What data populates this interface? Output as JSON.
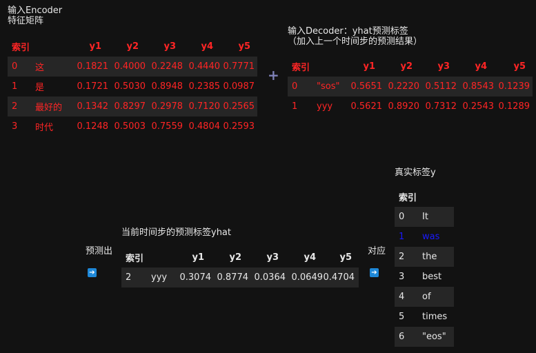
{
  "encoder": {
    "caption": "输入Encoder\n特征矩阵",
    "headers": [
      "索引",
      "",
      "y1",
      "y2",
      "y3",
      "y4",
      "y5"
    ],
    "rows": [
      [
        "0",
        "这",
        "0.1821",
        "0.4000",
        "0.2248",
        "0.4440",
        "0.7771"
      ],
      [
        "1",
        "是",
        "0.1721",
        "0.5030",
        "0.8948",
        "0.2385",
        "0.0987"
      ],
      [
        "2",
        "最好的",
        "0.1342",
        "0.8297",
        "0.2978",
        "0.7120",
        "0.2565"
      ],
      [
        "3",
        "时代",
        "0.1248",
        "0.5003",
        "0.7559",
        "0.4804",
        "0.2593"
      ]
    ]
  },
  "plus_symbol": "+",
  "decoder": {
    "caption": "输入Decoder：yhat预测标签\n（加入上一个时间步的预测结果）",
    "headers": [
      "索引",
      "",
      "y1",
      "y2",
      "y3",
      "y4",
      "y5"
    ],
    "rows": [
      [
        "0",
        "\"sos\"",
        "0.5651",
        "0.2220",
        "0.5112",
        "0.8543",
        "0.1239"
      ],
      [
        "1",
        "yyy",
        "0.5621",
        "0.8920",
        "0.7312",
        "0.2543",
        "0.1289"
      ]
    ]
  },
  "predict_label": "预测出",
  "prediction": {
    "caption": "当前时间步的预测标签yhat",
    "headers": [
      "索引",
      "",
      "y1",
      "y2",
      "y3",
      "y4",
      "y5"
    ],
    "rows": [
      [
        "2",
        "yyy",
        "0.3074",
        "0.8774",
        "0.0364",
        "0.0649",
        "0.4704"
      ]
    ]
  },
  "correspond_label": "对应",
  "truth": {
    "caption": "真实标签y",
    "headers": [
      "索引",
      ""
    ],
    "rows": [
      [
        "0",
        "It"
      ],
      [
        "1",
        "was"
      ],
      [
        "2",
        "the"
      ],
      [
        "3",
        "best"
      ],
      [
        "4",
        "of"
      ],
      [
        "5",
        "times"
      ],
      [
        "6",
        "\"eos\""
      ]
    ]
  },
  "colors": {
    "background": "#121212",
    "text": "#e8e8e8",
    "table_red": "#ff2525",
    "row_shade": "#262626",
    "highlight_blue": "#1a1aff",
    "arrow_icon": "#1e88d8",
    "plus": "#7f82b8"
  },
  "icons": [
    "arrow-right-icon",
    "plus-icon"
  ]
}
